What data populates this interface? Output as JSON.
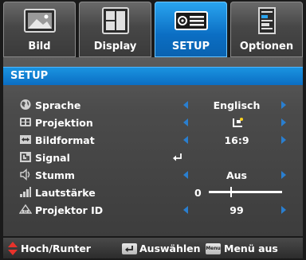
{
  "tabs": [
    {
      "label": "Bild",
      "icon": "picture-icon"
    },
    {
      "label": "Display",
      "icon": "display-icon"
    },
    {
      "label": "SETUP",
      "icon": "setup-icon"
    },
    {
      "label": "Optionen",
      "icon": "options-icon"
    }
  ],
  "active_tab": "SETUP",
  "panel": {
    "title": "SETUP",
    "rows": [
      {
        "label": "Sprache",
        "value": "Englisch",
        "icon": "globe-icon"
      },
      {
        "label": "Projektion",
        "value": "",
        "icon": "projection-icon"
      },
      {
        "label": "Bildformat",
        "value": "16:9",
        "icon": "aspect-ratio-icon"
      },
      {
        "label": "Signal",
        "value": "",
        "icon": "signal-icon"
      },
      {
        "label": "Stumm",
        "value": "Aus",
        "icon": "speaker-mute-icon"
      },
      {
        "label": "Lautstärke",
        "value": "0",
        "icon": "volume-bars-icon",
        "level": 0.3
      },
      {
        "label": "Projektor ID",
        "value": "99",
        "icon": "projector-id-icon"
      }
    ]
  },
  "footer": {
    "nav_label": "Hoch/Runter",
    "select_label": "Auswählen",
    "menu_key": "Menu",
    "menu_label": "Menü aus"
  },
  "colors": {
    "accent": "#0b6ec3",
    "arrow": "#2a7fd0",
    "footer_arrow": "#e8322b"
  }
}
